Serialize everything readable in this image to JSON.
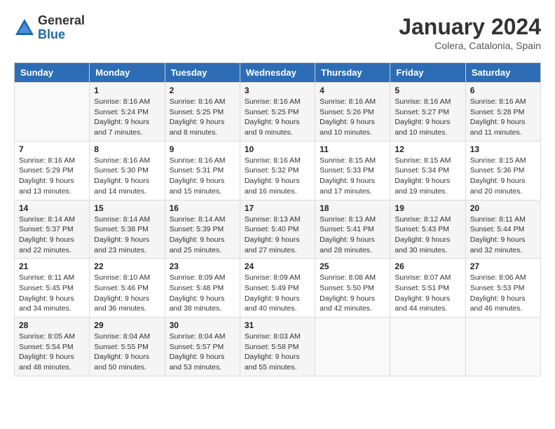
{
  "logo": {
    "general": "General",
    "blue": "Blue"
  },
  "title": "January 2024",
  "subtitle": "Colera, Catalonia, Spain",
  "days_header": [
    "Sunday",
    "Monday",
    "Tuesday",
    "Wednesday",
    "Thursday",
    "Friday",
    "Saturday"
  ],
  "weeks": [
    [
      {
        "num": "",
        "info": ""
      },
      {
        "num": "1",
        "info": "Sunrise: 8:16 AM\nSunset: 5:24 PM\nDaylight: 9 hours\nand 7 minutes."
      },
      {
        "num": "2",
        "info": "Sunrise: 8:16 AM\nSunset: 5:25 PM\nDaylight: 9 hours\nand 8 minutes."
      },
      {
        "num": "3",
        "info": "Sunrise: 8:16 AM\nSunset: 5:25 PM\nDaylight: 9 hours\nand 9 minutes."
      },
      {
        "num": "4",
        "info": "Sunrise: 8:16 AM\nSunset: 5:26 PM\nDaylight: 9 hours\nand 10 minutes."
      },
      {
        "num": "5",
        "info": "Sunrise: 8:16 AM\nSunset: 5:27 PM\nDaylight: 9 hours\nand 10 minutes."
      },
      {
        "num": "6",
        "info": "Sunrise: 8:16 AM\nSunset: 5:28 PM\nDaylight: 9 hours\nand 11 minutes."
      }
    ],
    [
      {
        "num": "7",
        "info": "Sunrise: 8:16 AM\nSunset: 5:29 PM\nDaylight: 9 hours\nand 13 minutes."
      },
      {
        "num": "8",
        "info": "Sunrise: 8:16 AM\nSunset: 5:30 PM\nDaylight: 9 hours\nand 14 minutes."
      },
      {
        "num": "9",
        "info": "Sunrise: 8:16 AM\nSunset: 5:31 PM\nDaylight: 9 hours\nand 15 minutes."
      },
      {
        "num": "10",
        "info": "Sunrise: 8:16 AM\nSunset: 5:32 PM\nDaylight: 9 hours\nand 16 minutes."
      },
      {
        "num": "11",
        "info": "Sunrise: 8:15 AM\nSunset: 5:33 PM\nDaylight: 9 hours\nand 17 minutes."
      },
      {
        "num": "12",
        "info": "Sunrise: 8:15 AM\nSunset: 5:34 PM\nDaylight: 9 hours\nand 19 minutes."
      },
      {
        "num": "13",
        "info": "Sunrise: 8:15 AM\nSunset: 5:36 PM\nDaylight: 9 hours\nand 20 minutes."
      }
    ],
    [
      {
        "num": "14",
        "info": "Sunrise: 8:14 AM\nSunset: 5:37 PM\nDaylight: 9 hours\nand 22 minutes."
      },
      {
        "num": "15",
        "info": "Sunrise: 8:14 AM\nSunset: 5:38 PM\nDaylight: 9 hours\nand 23 minutes."
      },
      {
        "num": "16",
        "info": "Sunrise: 8:14 AM\nSunset: 5:39 PM\nDaylight: 9 hours\nand 25 minutes."
      },
      {
        "num": "17",
        "info": "Sunrise: 8:13 AM\nSunset: 5:40 PM\nDaylight: 9 hours\nand 27 minutes."
      },
      {
        "num": "18",
        "info": "Sunrise: 8:13 AM\nSunset: 5:41 PM\nDaylight: 9 hours\nand 28 minutes."
      },
      {
        "num": "19",
        "info": "Sunrise: 8:12 AM\nSunset: 5:43 PM\nDaylight: 9 hours\nand 30 minutes."
      },
      {
        "num": "20",
        "info": "Sunrise: 8:11 AM\nSunset: 5:44 PM\nDaylight: 9 hours\nand 32 minutes."
      }
    ],
    [
      {
        "num": "21",
        "info": "Sunrise: 8:11 AM\nSunset: 5:45 PM\nDaylight: 9 hours\nand 34 minutes."
      },
      {
        "num": "22",
        "info": "Sunrise: 8:10 AM\nSunset: 5:46 PM\nDaylight: 9 hours\nand 36 minutes."
      },
      {
        "num": "23",
        "info": "Sunrise: 8:09 AM\nSunset: 5:48 PM\nDaylight: 9 hours\nand 38 minutes."
      },
      {
        "num": "24",
        "info": "Sunrise: 8:09 AM\nSunset: 5:49 PM\nDaylight: 9 hours\nand 40 minutes."
      },
      {
        "num": "25",
        "info": "Sunrise: 8:08 AM\nSunset: 5:50 PM\nDaylight: 9 hours\nand 42 minutes."
      },
      {
        "num": "26",
        "info": "Sunrise: 8:07 AM\nSunset: 5:51 PM\nDaylight: 9 hours\nand 44 minutes."
      },
      {
        "num": "27",
        "info": "Sunrise: 8:06 AM\nSunset: 5:53 PM\nDaylight: 9 hours\nand 46 minutes."
      }
    ],
    [
      {
        "num": "28",
        "info": "Sunrise: 8:05 AM\nSunset: 5:54 PM\nDaylight: 9 hours\nand 48 minutes."
      },
      {
        "num": "29",
        "info": "Sunrise: 8:04 AM\nSunset: 5:55 PM\nDaylight: 9 hours\nand 50 minutes."
      },
      {
        "num": "30",
        "info": "Sunrise: 8:04 AM\nSunset: 5:57 PM\nDaylight: 9 hours\nand 53 minutes."
      },
      {
        "num": "31",
        "info": "Sunrise: 8:03 AM\nSunset: 5:58 PM\nDaylight: 9 hours\nand 55 minutes."
      },
      {
        "num": "",
        "info": ""
      },
      {
        "num": "",
        "info": ""
      },
      {
        "num": "",
        "info": ""
      }
    ]
  ]
}
